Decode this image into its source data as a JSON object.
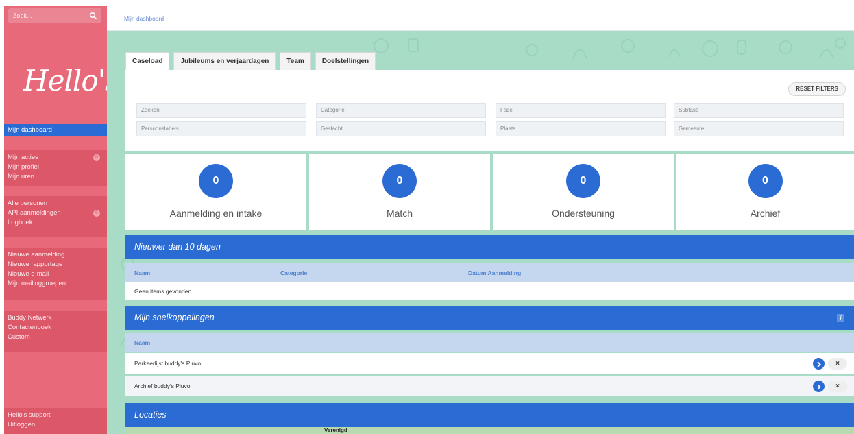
{
  "search": {
    "placeholder": "Zoek..."
  },
  "brand": {
    "logo_text": "Hello's"
  },
  "sidebar": {
    "active": {
      "label": "Mijn dashboard"
    },
    "group1": [
      {
        "label": "Mijn acties",
        "badge": "0"
      },
      {
        "label": "Mijn profiel"
      },
      {
        "label": "Mijn uren"
      }
    ],
    "group2": [
      {
        "label": "Alle personen"
      },
      {
        "label": "API aanmeldingen",
        "badge": "0"
      },
      {
        "label": "Logboek"
      }
    ],
    "group3": [
      {
        "label": "Nieuwe aanmelding"
      },
      {
        "label": "Nieuwe rapportage"
      },
      {
        "label": "Nieuwe e-mail"
      },
      {
        "label": "Mijn mailinggroepen"
      }
    ],
    "group4": [
      {
        "label": "Buddy Netwerk"
      },
      {
        "label": "Contactenboek"
      },
      {
        "label": "Custom"
      }
    ],
    "footer": [
      {
        "label": "Hello's support"
      },
      {
        "label": "Uitloggen"
      }
    ]
  },
  "breadcrumb": "Mijn dashboard",
  "tabs": [
    {
      "label": "Caseload"
    },
    {
      "label": "Jubileums en verjaardagen"
    },
    {
      "label": "Team"
    },
    {
      "label": "Doelstellingen"
    }
  ],
  "filters": {
    "reset_label": "RESET FILTERS",
    "fields": [
      "Zoeken",
      "Categorie",
      "Fase",
      "Subfase",
      "Persoonslabels",
      "Geslacht",
      "Plaats",
      "Gemeente"
    ]
  },
  "cards": [
    {
      "count": "0",
      "label": "Aanmelding en intake"
    },
    {
      "count": "0",
      "label": "Match"
    },
    {
      "count": "0",
      "label": "Ondersteuning"
    },
    {
      "count": "0",
      "label": "Archief"
    }
  ],
  "recent": {
    "title": "Nieuwer dan 10 dagen",
    "columns": [
      "Naam",
      "Categorie",
      "Datum Aanmelding"
    ],
    "empty": "Geen items gevonden"
  },
  "shortcuts": {
    "title": "Mijn snelkoppelingen",
    "info": "i",
    "column": "Naam",
    "items": [
      {
        "label": "Parkeerlijst buddy's Pluvo"
      },
      {
        "label": "Archief buddy's Pluvo"
      }
    ],
    "remove_label": "×"
  },
  "locations": {
    "title": "Locaties",
    "map_label": "Verenigd"
  },
  "colors": {
    "sidebar": "#e8697a",
    "accent": "#2b6cd4",
    "background": "#a9dcc6",
    "table_header": "#c5d6ef"
  }
}
